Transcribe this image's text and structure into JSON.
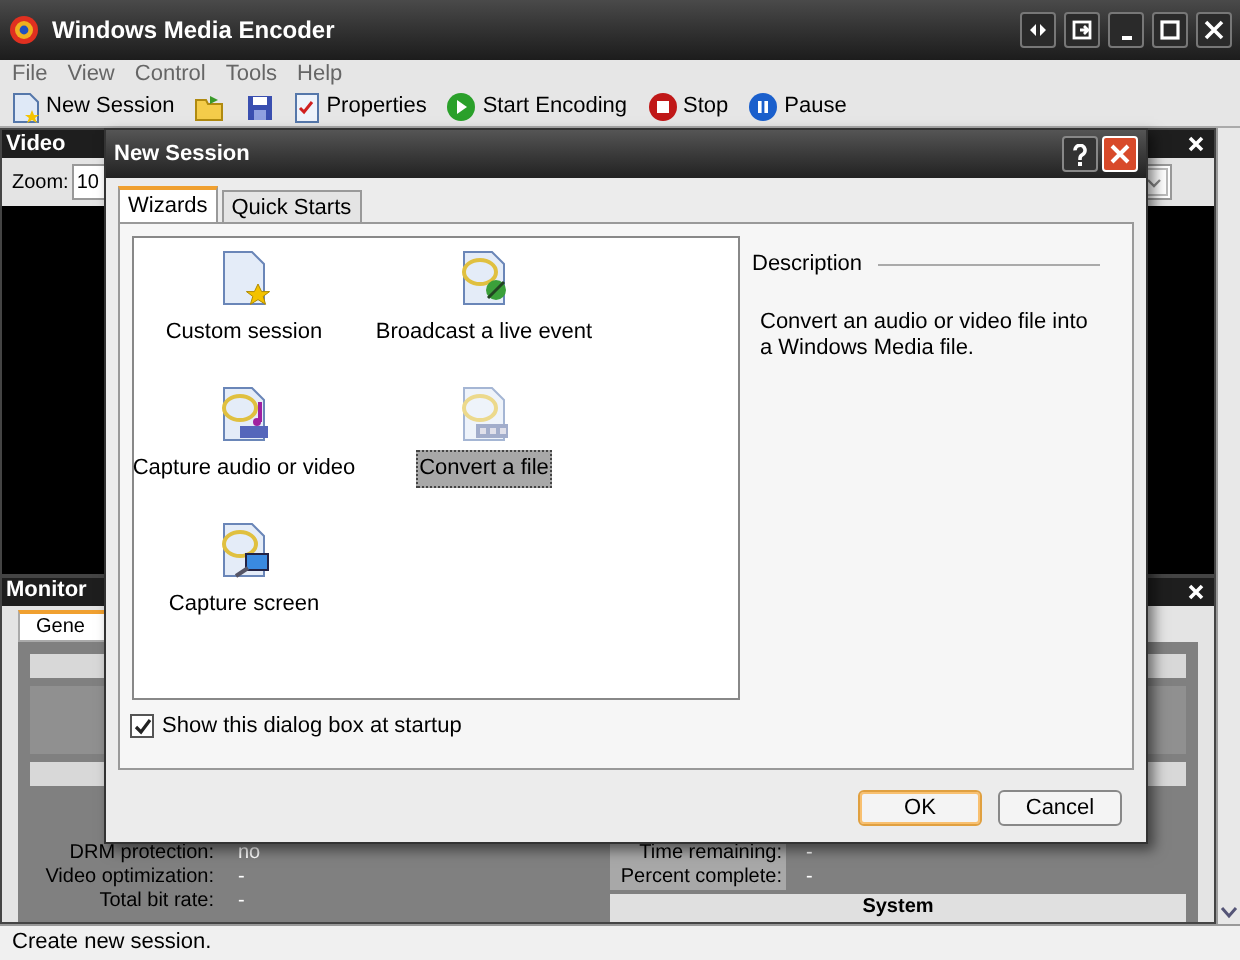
{
  "window": {
    "title": "Windows Media Encoder"
  },
  "menu": [
    "File",
    "View",
    "Control",
    "Tools",
    "Help"
  ],
  "toolbar": [
    {
      "kind": "new",
      "label": "New Session"
    },
    {
      "kind": "open"
    },
    {
      "kind": "save"
    },
    {
      "kind": "properties",
      "label": "Properties"
    },
    {
      "kind": "start",
      "label": "Start Encoding"
    },
    {
      "kind": "stop",
      "label": "Stop"
    },
    {
      "kind": "pause",
      "label": "Pause"
    }
  ],
  "video_panel": {
    "title": "Video",
    "zoom_label": "Zoom:",
    "zoom_value": "10"
  },
  "monitor_panel": {
    "title": "Monitor",
    "tab": "Gene",
    "left_rows": [
      {
        "label": "DRM protection:",
        "value": "no"
      },
      {
        "label": "Video optimization:",
        "value": "-"
      },
      {
        "label": "Total bit rate:",
        "value": "-"
      }
    ],
    "right_rows": [
      {
        "label": "Time remaining:",
        "value": "-"
      },
      {
        "label": "Percent complete:",
        "value": "-"
      }
    ],
    "system_header": "System"
  },
  "status_bar": "Create new session.",
  "dialog": {
    "title": "New Session",
    "tabs": [
      {
        "label": "Wizards",
        "selected": true
      },
      {
        "label": "Quick Starts",
        "selected": false
      }
    ],
    "wizards": [
      {
        "kind": "custom",
        "label": "Custom session",
        "selected": false
      },
      {
        "kind": "broadcast",
        "label": "Broadcast a live event",
        "selected": false
      },
      {
        "kind": "capture",
        "label": "Capture audio or video",
        "selected": false
      },
      {
        "kind": "convert",
        "label": "Convert a file",
        "selected": true
      },
      {
        "kind": "screen",
        "label": "Capture screen",
        "selected": false
      }
    ],
    "description_title": "Description",
    "description": "Convert an audio or video file into a Windows Media file.",
    "show_at_startup": {
      "label": "Show this dialog box at startup",
      "checked": true
    },
    "buttons": [
      {
        "label": "OK",
        "default": true
      },
      {
        "label": "Cancel",
        "default": false
      }
    ]
  }
}
